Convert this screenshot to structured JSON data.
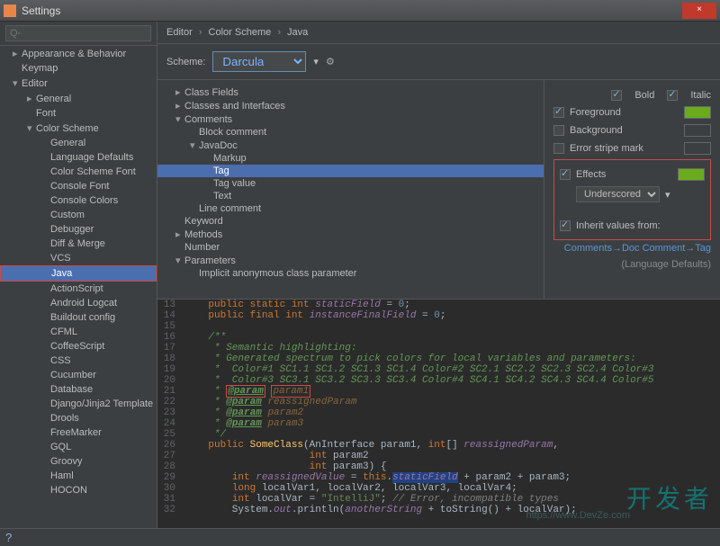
{
  "window": {
    "title": "Settings",
    "close": "×"
  },
  "search": {
    "placeholder": "Q-"
  },
  "sidebar": {
    "items": [
      {
        "label": "Appearance & Behavior",
        "lvl": 0,
        "exp": "▸"
      },
      {
        "label": "Keymap",
        "lvl": 0,
        "exp": " "
      },
      {
        "label": "Editor",
        "lvl": 0,
        "exp": "▾"
      },
      {
        "label": "General",
        "lvl": 1,
        "exp": "▸"
      },
      {
        "label": "Font",
        "lvl": 1,
        "exp": " "
      },
      {
        "label": "Color Scheme",
        "lvl": 1,
        "exp": "▾"
      },
      {
        "label": "General",
        "lvl": 2,
        "exp": " "
      },
      {
        "label": "Language Defaults",
        "lvl": 2,
        "exp": " "
      },
      {
        "label": "Color Scheme Font",
        "lvl": 2,
        "exp": " "
      },
      {
        "label": "Console Font",
        "lvl": 2,
        "exp": " "
      },
      {
        "label": "Console Colors",
        "lvl": 2,
        "exp": " "
      },
      {
        "label": "Custom",
        "lvl": 2,
        "exp": " "
      },
      {
        "label": "Debugger",
        "lvl": 2,
        "exp": " "
      },
      {
        "label": "Diff & Merge",
        "lvl": 2,
        "exp": " "
      },
      {
        "label": "VCS",
        "lvl": 2,
        "exp": " "
      },
      {
        "label": "Java",
        "lvl": 2,
        "exp": " ",
        "selected": true
      },
      {
        "label": "ActionScript",
        "lvl": 2,
        "exp": " "
      },
      {
        "label": "Android Logcat",
        "lvl": 2,
        "exp": " "
      },
      {
        "label": "Buildout config",
        "lvl": 2,
        "exp": " "
      },
      {
        "label": "CFML",
        "lvl": 2,
        "exp": " "
      },
      {
        "label": "CoffeeScript",
        "lvl": 2,
        "exp": " "
      },
      {
        "label": "CSS",
        "lvl": 2,
        "exp": " "
      },
      {
        "label": "Cucumber",
        "lvl": 2,
        "exp": " "
      },
      {
        "label": "Database",
        "lvl": 2,
        "exp": " "
      },
      {
        "label": "Django/Jinja2 Template",
        "lvl": 2,
        "exp": " "
      },
      {
        "label": "Drools",
        "lvl": 2,
        "exp": " "
      },
      {
        "label": "FreeMarker",
        "lvl": 2,
        "exp": " "
      },
      {
        "label": "GQL",
        "lvl": 2,
        "exp": " "
      },
      {
        "label": "Groovy",
        "lvl": 2,
        "exp": " "
      },
      {
        "label": "Haml",
        "lvl": 2,
        "exp": " "
      },
      {
        "label": "HOCON",
        "lvl": 2,
        "exp": " "
      }
    ]
  },
  "crumbs": {
    "a": "Editor",
    "b": "Color Scheme",
    "c": "Java"
  },
  "scheme": {
    "label": "Scheme:",
    "value": "Darcula"
  },
  "attributes": {
    "items": [
      {
        "label": "Class Fields",
        "lvl": 1,
        "exp": "▸"
      },
      {
        "label": "Classes and Interfaces",
        "lvl": 1,
        "exp": "▸"
      },
      {
        "label": "Comments",
        "lvl": 1,
        "exp": "▾"
      },
      {
        "label": "Block comment",
        "lvl": 2,
        "exp": " "
      },
      {
        "label": "JavaDoc",
        "lvl": 2,
        "exp": "▾"
      },
      {
        "label": "Markup",
        "lvl": 3,
        "exp": " "
      },
      {
        "label": "Tag",
        "lvl": 3,
        "exp": " ",
        "selected": true
      },
      {
        "label": "Tag value",
        "lvl": 3,
        "exp": " "
      },
      {
        "label": "Text",
        "lvl": 3,
        "exp": " "
      },
      {
        "label": "Line comment",
        "lvl": 2,
        "exp": " "
      },
      {
        "label": "Keyword",
        "lvl": 1,
        "exp": " "
      },
      {
        "label": "Methods",
        "lvl": 1,
        "exp": "▸"
      },
      {
        "label": "Number",
        "lvl": 1,
        "exp": " "
      },
      {
        "label": "Parameters",
        "lvl": 1,
        "exp": "▾"
      },
      {
        "label": "Implicit anonymous class parameter",
        "lvl": 2,
        "exp": " "
      }
    ]
  },
  "props": {
    "bold": "Bold",
    "italic": "Italic",
    "foreground": "Foreground",
    "background": "Background",
    "errorstripe": "Error stripe mark",
    "effects": "Effects",
    "effecttype": "Underscored",
    "inherit": "Inherit values from:",
    "inherit_link": "Comments→Doc Comment→Tag",
    "inherit_sub": "(Language Defaults)"
  },
  "preview": {
    "start": 13,
    "lines": [
      {
        "seg": [
          {
            "t": "    ",
            "c": "plain"
          },
          {
            "t": "public static int ",
            "c": "kw"
          },
          {
            "t": "staticField",
            "c": "id"
          },
          {
            "t": " = ",
            "c": "plain"
          },
          {
            "t": "0",
            "c": "num"
          },
          {
            "t": ";",
            "c": "plain"
          }
        ]
      },
      {
        "seg": [
          {
            "t": "    ",
            "c": "plain"
          },
          {
            "t": "public final int ",
            "c": "kw"
          },
          {
            "t": "instanceFinalField",
            "c": "id"
          },
          {
            "t": " = ",
            "c": "plain"
          },
          {
            "t": "0",
            "c": "num"
          },
          {
            "t": ";",
            "c": "plain"
          }
        ]
      },
      {
        "seg": []
      },
      {
        "seg": [
          {
            "t": "    /**",
            "c": "doc"
          }
        ]
      },
      {
        "seg": [
          {
            "t": "     * Semantic highlighting:",
            "c": "doc"
          }
        ]
      },
      {
        "seg": [
          {
            "t": "     * Generated spectrum to pick colors for local variables and parameters:",
            "c": "doc"
          }
        ]
      },
      {
        "seg": [
          {
            "t": "     *  Color#1 SC1.1 SC1.2 SC1.3 SC1.4 Color#2 SC2.1 SC2.2 SC2.3 SC2.4 Color#3",
            "c": "doc"
          }
        ]
      },
      {
        "seg": [
          {
            "t": "     *  Color#3 SC3.1 SC3.2 SC3.3 SC3.4 Color#4 SC4.1 SC4.2 SC4.3 SC4.4 Color#5",
            "c": "doc"
          }
        ]
      },
      {
        "seg": [
          {
            "t": "     * ",
            "c": "doc"
          },
          {
            "t": "@param",
            "c": "doctag",
            "hl": true
          },
          {
            "t": " ",
            "c": "doc"
          },
          {
            "t": "param1",
            "c": "docparam",
            "hl": true
          }
        ]
      },
      {
        "seg": [
          {
            "t": "     * ",
            "c": "doc"
          },
          {
            "t": "@param",
            "c": "doctag"
          },
          {
            "t": " ",
            "c": "doc"
          },
          {
            "t": "reassignedParam",
            "c": "docparam"
          }
        ]
      },
      {
        "seg": [
          {
            "t": "     * ",
            "c": "doc"
          },
          {
            "t": "@param",
            "c": "doctag"
          },
          {
            "t": " ",
            "c": "doc"
          },
          {
            "t": "param2",
            "c": "docparam"
          }
        ]
      },
      {
        "seg": [
          {
            "t": "     * ",
            "c": "doc"
          },
          {
            "t": "@param",
            "c": "doctag"
          },
          {
            "t": " ",
            "c": "doc"
          },
          {
            "t": "param3",
            "c": "docparam"
          }
        ]
      },
      {
        "seg": [
          {
            "t": "     */",
            "c": "doc"
          }
        ]
      },
      {
        "seg": [
          {
            "t": "    ",
            "c": "plain"
          },
          {
            "t": "public ",
            "c": "kw"
          },
          {
            "t": "SomeClass",
            "c": "fn"
          },
          {
            "t": "(AnInterface param1, ",
            "c": "plain"
          },
          {
            "t": "int",
            "c": "kw"
          },
          {
            "t": "[] ",
            "c": "plain"
          },
          {
            "t": "reassignedParam",
            "c": "id"
          },
          {
            "t": ",",
            "c": "plain"
          }
        ]
      },
      {
        "seg": [
          {
            "t": "                     ",
            "c": "plain"
          },
          {
            "t": "int ",
            "c": "kw"
          },
          {
            "t": "param2",
            "c": "plain"
          }
        ]
      },
      {
        "seg": [
          {
            "t": "                     ",
            "c": "plain"
          },
          {
            "t": "int ",
            "c": "kw"
          },
          {
            "t": "param3) {",
            "c": "plain"
          }
        ]
      },
      {
        "seg": [
          {
            "t": "        ",
            "c": "plain"
          },
          {
            "t": "int ",
            "c": "kw"
          },
          {
            "t": "reassignedValue",
            "c": "id"
          },
          {
            "t": " = ",
            "c": "plain"
          },
          {
            "t": "this",
            "c": "kw"
          },
          {
            "t": ".",
            "c": "plain"
          },
          {
            "t": "staticField",
            "c": "id sel-bg"
          },
          {
            "t": " + param2 + param3;",
            "c": "plain"
          }
        ]
      },
      {
        "seg": [
          {
            "t": "        ",
            "c": "plain"
          },
          {
            "t": "long ",
            "c": "kw"
          },
          {
            "t": "localVar1, localVar2, localVar3, localVar4;",
            "c": "plain"
          }
        ]
      },
      {
        "seg": [
          {
            "t": "        ",
            "c": "plain"
          },
          {
            "t": "int ",
            "c": "kw"
          },
          {
            "t": "localVar = ",
            "c": "plain"
          },
          {
            "t": "\"IntelliJ\"",
            "c": "str"
          },
          {
            "t": "; ",
            "c": "plain"
          },
          {
            "t": "// Error, incompatible types",
            "c": "comm"
          }
        ]
      },
      {
        "seg": [
          {
            "t": "        System.",
            "c": "plain"
          },
          {
            "t": "out",
            "c": "id"
          },
          {
            "t": ".println(",
            "c": "plain"
          },
          {
            "t": "anotherString",
            "c": "id"
          },
          {
            "t": " + toString() + localVar);",
            "c": "plain"
          }
        ]
      }
    ]
  },
  "watermark": "开发者",
  "url_mark": "https://www.DevZe.com"
}
